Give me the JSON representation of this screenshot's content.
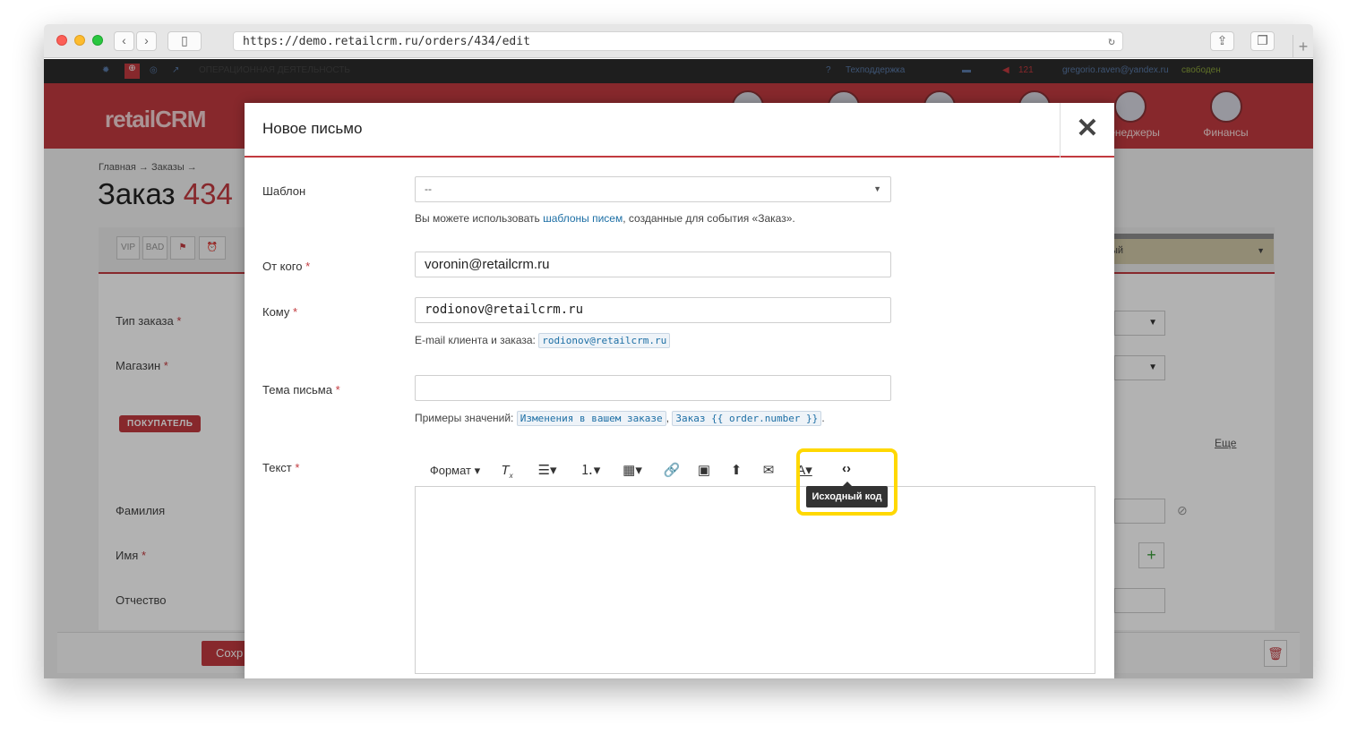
{
  "browser": {
    "url": "https://demo.retailcrm.ru/orders/434/edit"
  },
  "topbar": {
    "section": "ОПЕРАЦИОННАЯ ДЕЯТЕЛЬНОСТЬ",
    "support": "Техподдержка",
    "notif_count": "121",
    "user_email": "gregorio.raven@yandex.ru",
    "user_status": "свободен"
  },
  "logo": "retailCRM",
  "nav": [
    {
      "label": "Менеджеры",
      "icon": "managers-icon"
    },
    {
      "label": "Финансы",
      "icon": "finance-icon"
    }
  ],
  "page": {
    "breadcrumb": "Главная → Заказы →",
    "title": "Заказ",
    "order_number": "434",
    "tags": [
      "VIP",
      "BAD"
    ],
    "status_partial": "ый",
    "fields": {
      "order_type": "Тип заказа",
      "shop": "Магазин",
      "last_name": "Фамилия",
      "first_name": "Имя",
      "patronymic": "Отчество"
    },
    "buyer_section": "ПОКУПАТЕЛЬ",
    "more": "Еще",
    "save_label": "Сохр"
  },
  "modal": {
    "title": "Новое письмо",
    "close": "✕",
    "template_label": "Шаблон",
    "template_value": "--",
    "template_hint_before": "Вы можете использовать",
    "template_hint_link": "шаблоны писем",
    "template_hint_after": ", созданные для события «Заказ».",
    "from_label": "От кого",
    "from_value": "voronin@retailcrm.ru",
    "to_label": "Кому",
    "to_value": "rodionov@retailcrm.ru",
    "to_hint": "E-mail клиента и заказа:",
    "to_hint_email": "rodionov@retailcrm.ru",
    "subject_label": "Тема письма",
    "subject_value": "",
    "subject_hint": "Примеры значений:",
    "subject_example_1": "Изменения в вашем заказе",
    "subject_example_2": "Заказ {{ order.number }}",
    "text_label": "Текст",
    "toolbar": {
      "format": "Формат",
      "source_tooltip": "Исходный код"
    },
    "editor_content": ""
  },
  "colors": {
    "brand_red": "#c23a3f",
    "highlight": "#ffd800",
    "link": "#1d6fa5"
  }
}
